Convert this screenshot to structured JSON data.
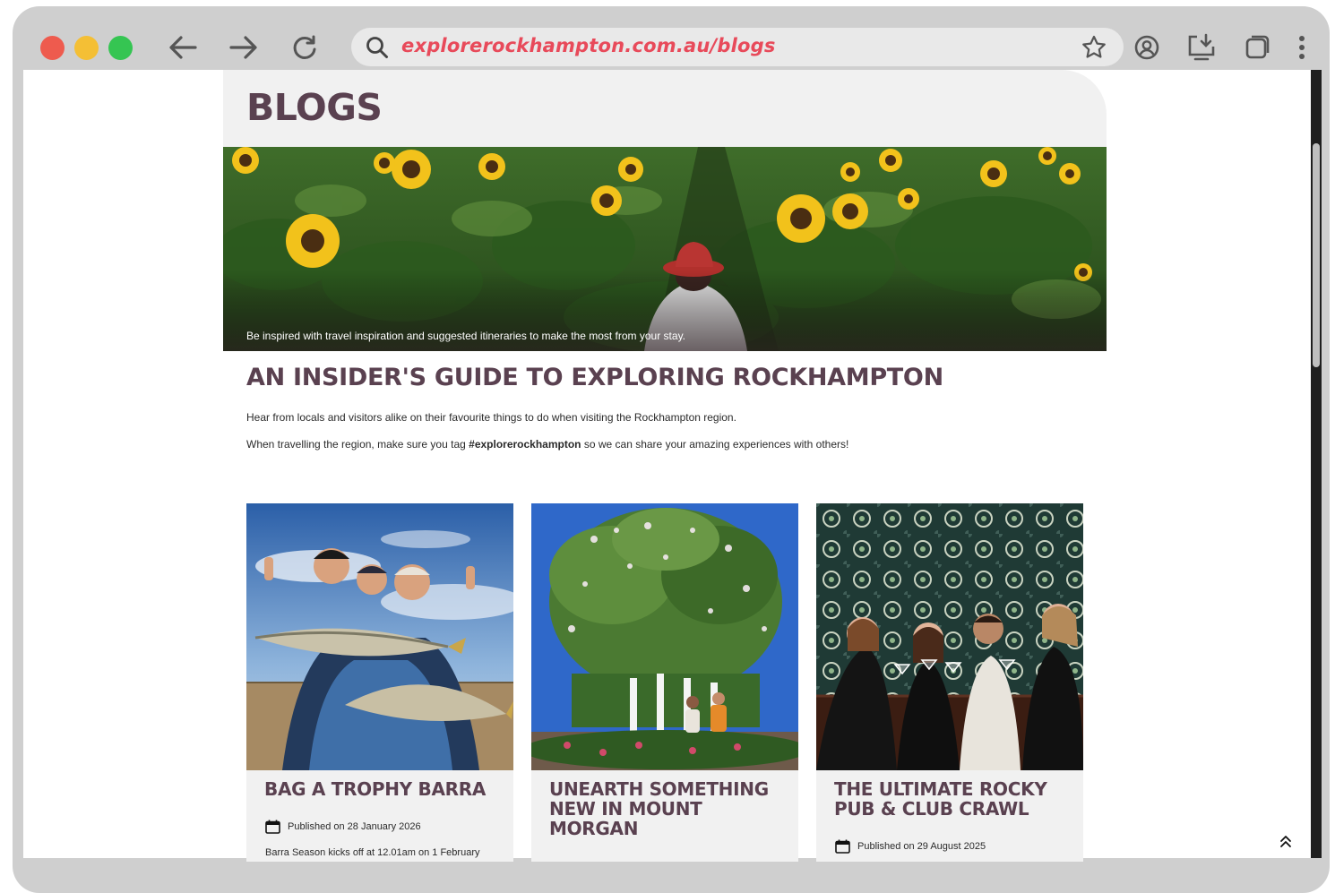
{
  "browser": {
    "url": "explorerockhampton.com.au/blogs",
    "accent_color": "#e84a5a",
    "traffic_lights": [
      "#ee5b4e",
      "#f4bf35",
      "#35c552"
    ],
    "icons": [
      "back-arrow-icon",
      "forward-arrow-icon",
      "reload-icon",
      "search-icon",
      "star-icon",
      "account-icon",
      "install-icon",
      "tab-icon",
      "more-icon"
    ]
  },
  "page": {
    "title": "BLOGS",
    "hero_caption": "Be inspired with travel inspiration and suggested itineraries to make the most from your stay.",
    "section_heading": "AN INSIDER'S GUIDE TO EXPLORING ROCKHAMPTON",
    "intro_line1": "Hear from locals and visitors alike on their favourite things to do when visiting the Rockhampton region.",
    "intro_line2_prefix": "When travelling the region, make sure you tag ",
    "intro_hashtag": "#explorerockhampton",
    "intro_line2_suffix": " so we can share your amazing experiences with others!",
    "heading_color": "#5a4150"
  },
  "cards": [
    {
      "title": "BAG A TROPHY BARRA",
      "published": "Published on 28 January 2026",
      "excerpt": "Barra Season kicks off at 12.01am on 1 February"
    },
    {
      "title": "UNEARTH SOMETHING NEW IN MOUNT MORGAN",
      "published": "",
      "excerpt": ""
    },
    {
      "title": "THE ULTIMATE ROCKY PUB & CLUB CRAWL",
      "published": "Published on 29 August 2025",
      "excerpt": ""
    }
  ]
}
